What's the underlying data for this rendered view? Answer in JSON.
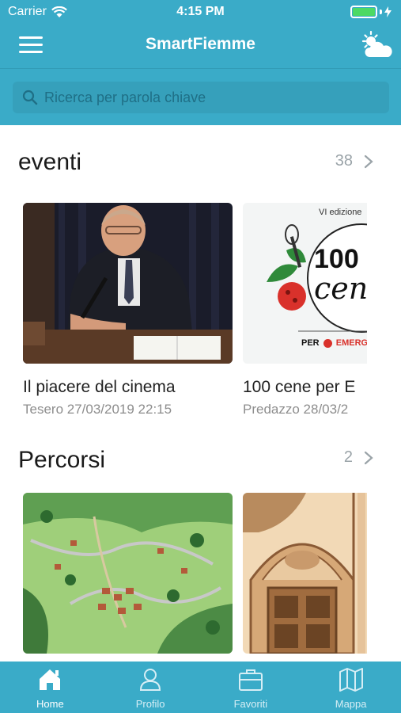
{
  "status_bar": {
    "carrier": "Carrier",
    "time": "4:15 PM"
  },
  "header": {
    "title": "SmartFiemme"
  },
  "search": {
    "placeholder": "Ricerca per parola chiave"
  },
  "sections": [
    {
      "title": "eventi",
      "count": "38",
      "cards": [
        {
          "title": "Il piacere del cinema",
          "subtitle": "Tesero 27/03/2019 22:15"
        },
        {
          "title": "100 cene per E",
          "subtitle": "Predazzo 28/03/2",
          "image_text": {
            "edition": "VI edizione",
            "logo_number": "100",
            "logo_word": "cen",
            "footer": "PER",
            "footer_brand": "EMERGE"
          }
        }
      ]
    },
    {
      "title": "Percorsi",
      "count": "2",
      "cards": [
        {
          "title": "",
          "subtitle": ""
        },
        {
          "title": "",
          "subtitle": ""
        }
      ]
    }
  ],
  "tabs": [
    {
      "label": "Home",
      "icon": "home-icon",
      "active": true
    },
    {
      "label": "Profilo",
      "icon": "profile-icon",
      "active": false
    },
    {
      "label": "Favoriti",
      "icon": "briefcase-icon",
      "active": false
    },
    {
      "label": "Mappa",
      "icon": "map-icon",
      "active": false
    }
  ],
  "colors": {
    "brand": "#3aabc8",
    "battery": "#4cd964"
  }
}
